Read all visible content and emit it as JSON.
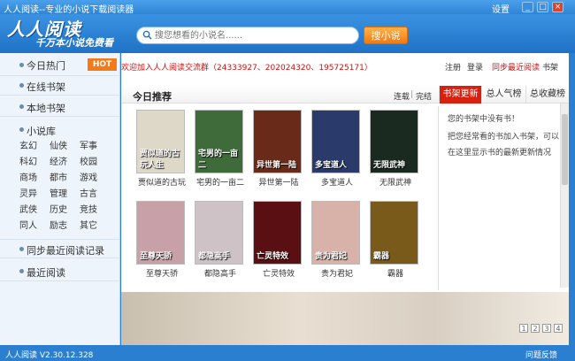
{
  "window": {
    "title": "人人阅读--专业的小说下载阅读器",
    "settings": "设置",
    "min": "_",
    "max": "□",
    "close": "×"
  },
  "header": {
    "logo": "人人阅读",
    "slogan": "千万本小说免费看",
    "search_placeholder": "搜您想看的小说名......",
    "search_button": "搜小说"
  },
  "sidebar": {
    "items": [
      {
        "label": "今日热门"
      },
      {
        "label": "在线书架"
      },
      {
        "label": "本地书架"
      },
      {
        "label": "小说库"
      }
    ],
    "hot_badge": "HOT",
    "categories": [
      [
        "玄幻",
        "仙侠",
        "军事"
      ],
      [
        "科幻",
        "经济",
        "校园"
      ],
      [
        "商场",
        "都市",
        "游戏"
      ],
      [
        "灵异",
        "管理",
        "古言"
      ],
      [
        "武侠",
        "历史",
        "竞技"
      ],
      [
        "同人",
        "励志",
        "其它"
      ]
    ],
    "bottom_items": [
      {
        "label": "同步最近阅读记录"
      },
      {
        "label": "最近阅读"
      }
    ]
  },
  "content": {
    "welcome": "欢迎加入人人阅读交流群（24333927、202024320、195725171）",
    "links": {
      "register": "注册",
      "login": "登录",
      "sync": "同步最近阅读",
      "shelf": "书架"
    },
    "section_title": "今日推荐",
    "status_filter": {
      "serial": "连载",
      "finished": "完结"
    },
    "tabs": [
      "书架更新",
      "总人气榜",
      "总收藏榜"
    ],
    "books": [
      {
        "name": "贾似道的古玩",
        "cover": "贾似道的古玩人生",
        "color": "#ddd8c8"
      },
      {
        "name": "宅男的一亩二",
        "cover": "宅男的一亩二",
        "color": "#3f6b3a"
      },
      {
        "name": "异世第一陆",
        "cover": "异世第一陆",
        "color": "#6a2a1a"
      },
      {
        "name": "多宝道人",
        "cover": "多宝道人",
        "color": "#2a3a6a"
      },
      {
        "name": "无限武神",
        "cover": "无限武神",
        "color": "#1a2a20"
      },
      {
        "name": "至尊天骄",
        "cover": "至尊天骄",
        "color": "#c8a0a8"
      },
      {
        "name": "都隐高手",
        "cover": "都隐高手",
        "color": "#cfc2c6"
      },
      {
        "name": "亡灵特效",
        "cover": "亡灵特效",
        "color": "#5a0f12"
      },
      {
        "name": "贵为君妃",
        "cover": "贵为君妃",
        "color": "#d8b2a8"
      },
      {
        "name": "霸器",
        "cover": "霸器",
        "color": "#7a5a1a"
      }
    ],
    "hints": [
      "您的书架中没有书！",
      "把您经常看的书加入书架，可以",
      "在这里显示书的最新更新情况"
    ],
    "pages": [
      "1",
      "2",
      "3",
      "4"
    ]
  },
  "status": {
    "version": "人人阅读 V2.30.12.328",
    "feedback": "问题反馈"
  }
}
